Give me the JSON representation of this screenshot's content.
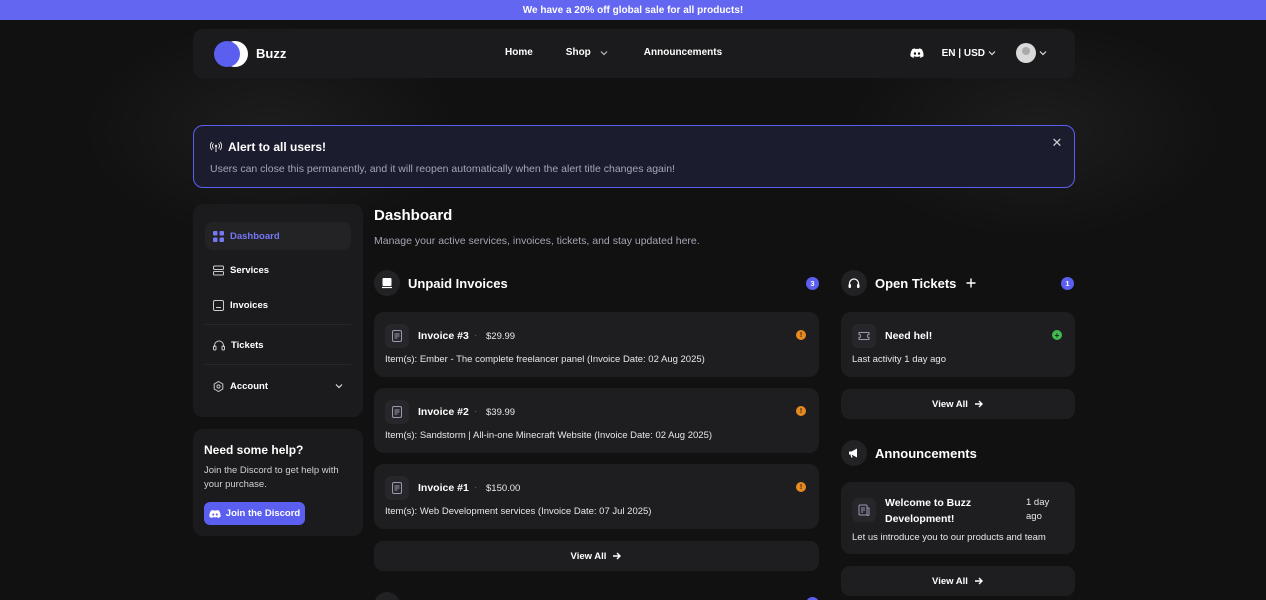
{
  "banner": {
    "text": "We have a 20% off global sale for all products!"
  },
  "brand": {
    "name": "Buzz"
  },
  "nav": {
    "links": [
      {
        "label": "Home"
      },
      {
        "label": "Shop"
      },
      {
        "label": "Announcements"
      }
    ],
    "locale": "EN | USD"
  },
  "alert": {
    "title": "Alert to all users!",
    "text": "Users can close this permanently, and it will reopen automatically when the alert title changes again!",
    "close": "✕"
  },
  "sidebar": {
    "items": [
      {
        "label": "Dashboard"
      },
      {
        "label": "Services"
      },
      {
        "label": "Invoices"
      },
      {
        "label": "Tickets"
      },
      {
        "label": "Account"
      }
    ]
  },
  "help": {
    "title": "Need some help?",
    "text": "Join the Discord to get help with your purchase.",
    "button": "Join the Discord"
  },
  "main": {
    "title": "Dashboard",
    "subtitle": "Manage your active services, invoices, tickets, and stay updated here."
  },
  "invoices": {
    "title": "Unpaid Invoices",
    "count": "3",
    "items": [
      {
        "name": "Invoice #3",
        "amount": "$29.99",
        "items": "Item(s): Ember - The complete freelancer panel (Invoice Date: 02 Aug 2025)"
      },
      {
        "name": "Invoice #2",
        "amount": "$39.99",
        "items": "Item(s): Sandstorm | All-in-one Minecraft Website (Invoice Date: 02 Aug 2025)"
      },
      {
        "name": "Invoice #1",
        "amount": "$150.00",
        "items": "Item(s): Web Development services (Invoice Date: 07 Jul 2025)"
      }
    ],
    "view_all": "View All"
  },
  "tickets": {
    "title": "Open Tickets",
    "count": "1",
    "items": [
      {
        "name": "Need hel!",
        "activity": "Last activity 1 day ago"
      }
    ],
    "view_all": "View All"
  },
  "announcements": {
    "title": "Announcements",
    "items": [
      {
        "title": "Welcome to Buzz Development!",
        "time": "1 day ago",
        "text": "Let us introduce you to our products and team"
      }
    ],
    "view_all": "View All"
  },
  "colors": {
    "accent": "#5b5ff0",
    "warning": "#e68a1f",
    "success": "#3fb950",
    "background": "#111112",
    "card": "#1e1e20"
  }
}
